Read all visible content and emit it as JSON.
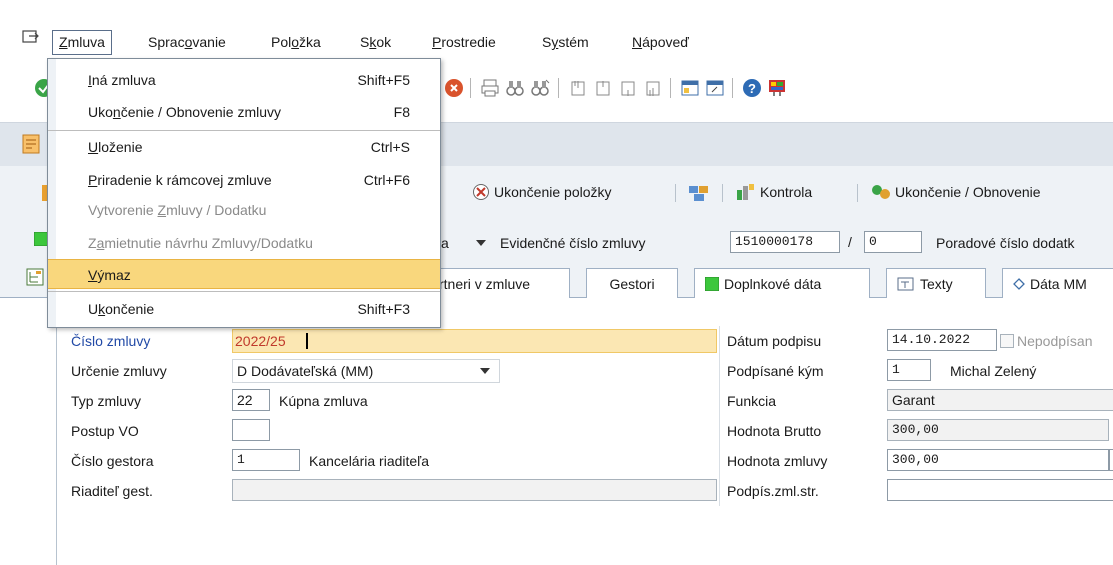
{
  "menubar": {
    "items": [
      {
        "pre": "",
        "u": "Z",
        "post": "mluva"
      },
      {
        "pre": "Sprac",
        "u": "o",
        "post": "vanie"
      },
      {
        "pre": "Pol",
        "u": "o",
        "post": "žka"
      },
      {
        "pre": "S",
        "u": "k",
        "post": "ok"
      },
      {
        "pre": "",
        "u": "P",
        "post": "rostredie"
      },
      {
        "pre": "S",
        "u": "y",
        "post": "stém"
      },
      {
        "pre": "",
        "u": "N",
        "post": "ápoveď"
      }
    ]
  },
  "dropdown": {
    "items": [
      {
        "pre": "",
        "u": "I",
        "post": "ná zmluva",
        "shortcut": "Shift+F5",
        "state": "normal"
      },
      {
        "pre": "Uko",
        "u": "n",
        "post": "čenie / Obnovenie zmluvy",
        "shortcut": "F8",
        "state": "normal"
      },
      {
        "pre": "",
        "u": "U",
        "post": "loženie",
        "shortcut": "Ctrl+S",
        "state": "normal"
      },
      {
        "pre": "",
        "u": "P",
        "post": "riradenie k rámcovej zmluve",
        "shortcut": "Ctrl+F6",
        "state": "normal"
      },
      {
        "pre": "Vytvorenie ",
        "u": "Z",
        "post": "mluvy / Dodatku",
        "shortcut": "",
        "state": "disabled"
      },
      {
        "pre": "Z",
        "u": "a",
        "post": "mietnutie návrhu Zmluvy/Dodatku",
        "shortcut": "",
        "state": "disabled"
      },
      {
        "pre": "",
        "u": "V",
        "post": "ýmaz",
        "shortcut": "",
        "state": "selected"
      },
      {
        "pre": "U",
        "u": "k",
        "post": "ončenie",
        "shortcut": "Shift+F3",
        "state": "normal"
      }
    ]
  },
  "appbar": {
    "ukoncenie_polozky": "Ukončenie položky",
    "kontrola": "Kontrola",
    "ukoncenie_obnovenie": "Ukončenie / Obnovenie"
  },
  "header": {
    "partial_a": "a",
    "evidencne_label": "Evidenčné číslo zmluvy",
    "evidencne_value": "1510000178",
    "slash": "/",
    "sub_value": "0",
    "poradove_label": "Poradové číslo dodatk"
  },
  "tabs": {
    "partneri": "rtneri v zmluve",
    "gestori": "Gestori",
    "doplnkove": "Doplnkové dáta",
    "texty": "Texty",
    "data_mm": "Dáta MM"
  },
  "form": {
    "cislo_zmluvy_label": "Číslo zmluvy",
    "cislo_zmluvy_value": "2022/25",
    "urcenie_label": "Určenie zmluvy",
    "urcenie_value": "D Dodávateľská (MM)",
    "typ_label": "Typ zmluvy",
    "typ_value": "22",
    "typ_text": "Kúpna zmluva",
    "postup_label": "Postup VO",
    "postup_value": "",
    "gestor_label": "Číslo gestora",
    "gestor_value": "1",
    "gestor_text": "Kancelária riaditeľa",
    "riaditel_label": "Riaditeľ gest.",
    "riaditel_value": "",
    "datum_label": "Dátum podpisu",
    "datum_value": "14.10.2022",
    "nepodpisana_label": "Nepodpísan",
    "podpisane_label": "Podpísané kým",
    "podpisane_value": "1",
    "podpisane_text": "Michal Zelený",
    "funkcia_label": "Funkcia",
    "funkcia_value": "Garant",
    "brutto_label": "Hodnota Brutto",
    "brutto_value": "300,00",
    "hodnota_label": "Hodnota zmluvy",
    "hodnota_value": "300,00",
    "podpis_str_label": "Podpís.zml.str.",
    "podpis_str_value": ""
  },
  "colors": {
    "highlight": "#f9d77d",
    "link": "#2149a6",
    "field_red": "#c0392b"
  }
}
